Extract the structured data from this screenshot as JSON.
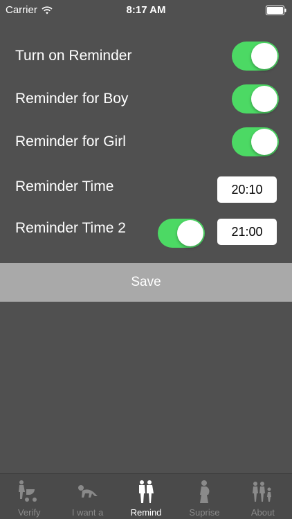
{
  "status_bar": {
    "carrier": "Carrier",
    "time": "8:17 AM"
  },
  "settings": {
    "turn_on_reminder": {
      "label": "Turn on Reminder",
      "enabled": true
    },
    "reminder_boy": {
      "label": "Reminder for Boy",
      "enabled": true
    },
    "reminder_girl": {
      "label": "Reminder for Girl",
      "enabled": true
    },
    "reminder_time": {
      "label": "Reminder Time",
      "value": "20:10"
    },
    "reminder_time_2": {
      "label": "Reminder Time 2",
      "enabled": true,
      "value": "21:00"
    }
  },
  "save_label": "Save",
  "tabs": [
    {
      "label": "Verify",
      "icon": "stroller-icon",
      "active": false
    },
    {
      "label": "I want a",
      "icon": "crawling-baby-icon",
      "active": false
    },
    {
      "label": "Remind",
      "icon": "parents-icon",
      "active": true
    },
    {
      "label": "Suprise",
      "icon": "pregnant-woman-icon",
      "active": false
    },
    {
      "label": "About",
      "icon": "family-icon",
      "active": false
    }
  ],
  "colors": {
    "background": "#505050",
    "toggle_on": "#4cd964",
    "save_bg": "#a9a9a9",
    "tab_bar": "#4a4a4a"
  }
}
